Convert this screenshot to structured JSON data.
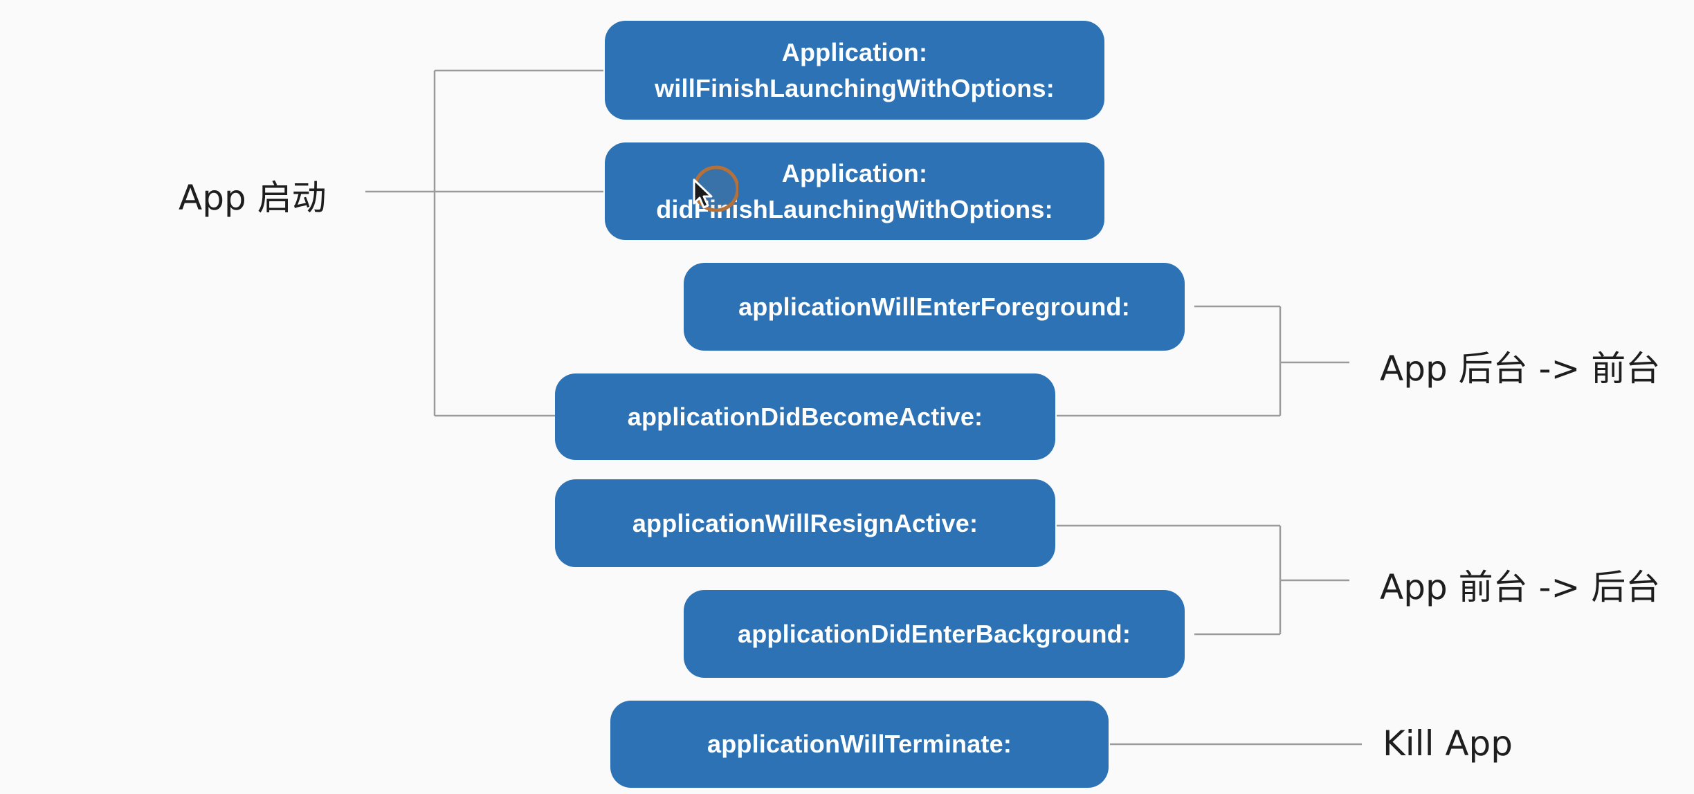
{
  "boxes": {
    "will_finish": {
      "line1": "Application:",
      "line2": "willFinishLaunchingWithOptions:"
    },
    "did_finish": {
      "line1": "Application:",
      "line2": "didFinishLaunchingWithOptions:"
    },
    "will_enter_foreground": "applicationWillEnterForeground:",
    "did_become_active": "applicationDidBecomeActive:",
    "will_resign_active": "applicationWillResignActive:",
    "did_enter_background": "applicationDidEnterBackground:",
    "will_terminate": "applicationWillTerminate:"
  },
  "labels": {
    "app_launch": "App 启动",
    "background_to_foreground": "App 后台 -> 前台",
    "foreground_to_background": "App 前台 -> 后台",
    "kill_app": "Kill App"
  },
  "colors": {
    "box_fill": "#2c72b5",
    "box_text": "#ffffff",
    "connector_line": "#9a9a9a",
    "label_text": "#1e1e1e",
    "cursor_ring": "#b5713a",
    "background": "#fafafa"
  },
  "icons": {
    "cursor": "mouse-pointer-icon"
  }
}
